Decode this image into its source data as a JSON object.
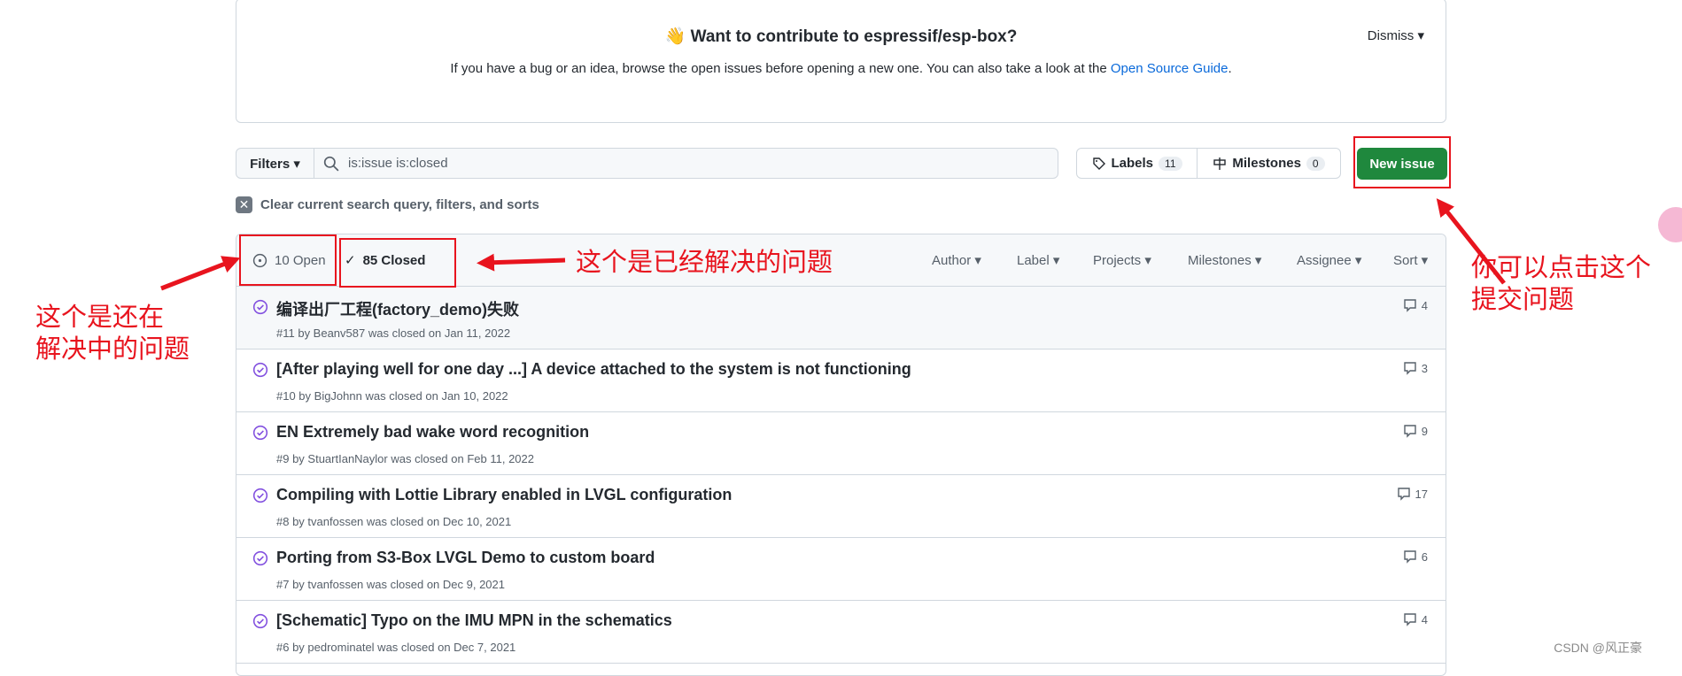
{
  "banner": {
    "emoji": "👋",
    "title": "Want to contribute to espressif/esp-box?",
    "text": "If you have a bug or an idea, browse the open issues before opening a new one. You can also take a look at the ",
    "link": "Open Source Guide",
    "end": ".",
    "dismiss": "Dismiss ▾"
  },
  "toolbar": {
    "filters": "Filters ▾",
    "search_value": "is:issue is:closed",
    "labels": "Labels",
    "labels_count": "11",
    "milestones": "Milestones",
    "milestones_count": "0",
    "new_issue": "New issue"
  },
  "clear": "Clear current search query, filters, and sorts",
  "states": {
    "open": "10 Open",
    "closed": "85 Closed"
  },
  "dropdowns": [
    "Author ▾",
    "Label ▾",
    "Projects ▾",
    "Milestones ▾",
    "Assignee ▾",
    "Sort ▾"
  ],
  "issues": [
    {
      "title": "编译出厂工程(factory_demo)失败",
      "meta": "#11 by Beanv587 was closed on Jan 11, 2022",
      "comments": "4"
    },
    {
      "title": "[After playing well for one day ...] A device attached to the system is not functioning",
      "meta": "#10 by BigJohnn was closed on Jan 10, 2022",
      "comments": "3"
    },
    {
      "title": "EN Extremely bad wake word recognition",
      "meta": "#9 by StuartIanNaylor was closed on Feb 11, 2022",
      "comments": "9"
    },
    {
      "title": "Compiling with Lottie Library enabled in LVGL configuration",
      "meta": "#8 by tvanfossen was closed on Dec 10, 2021",
      "comments": "17"
    },
    {
      "title": "Porting from S3-Box LVGL Demo to custom board",
      "meta": "#7 by tvanfossen was closed on Dec 9, 2021",
      "comments": "6"
    },
    {
      "title": "[Schematic] Typo on the IMU MPN in the schematics",
      "meta": "#6 by pedrominatel was closed on Dec 7, 2021",
      "comments": "4"
    }
  ],
  "annotations": {
    "open_line1": "这个是还在",
    "open_line2": "解决中的问题",
    "closed": "这个是已经解决的问题",
    "new_line1": "你可以点击这个",
    "new_line2": "提交问题"
  },
  "watermark": "CSDN @风正豪",
  "colors": {
    "accent": "#1f883d",
    "link": "#0969da",
    "closed_icon": "#8250df",
    "annotation": "#e8141e"
  }
}
